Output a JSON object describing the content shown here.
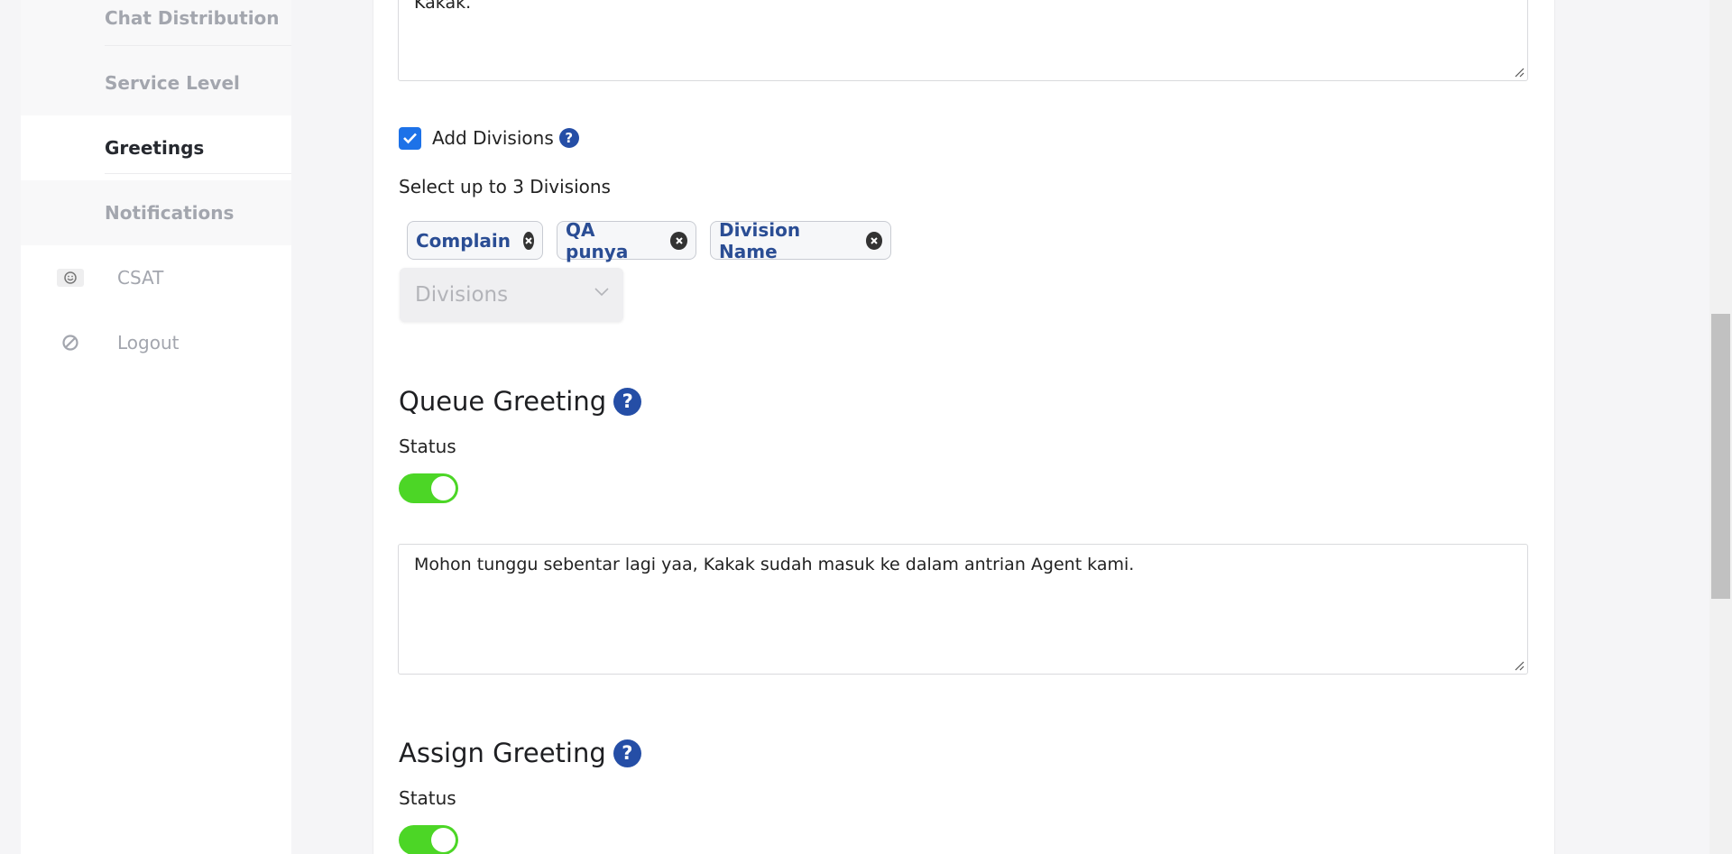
{
  "sidebar": {
    "sub_items": [
      {
        "label": "Chat Distribution"
      },
      {
        "label": "Service Level"
      },
      {
        "label": "Greetings"
      },
      {
        "label": "Notifications"
      }
    ],
    "csat_label": "CSAT",
    "logout_label": "Logout"
  },
  "greeting_top": {
    "text": "Kakak."
  },
  "divisions": {
    "checkbox_label": "Add Divisions",
    "checked": true,
    "help": "?",
    "hint": "Select up to 3 Divisions",
    "chips": [
      "Complain",
      "QA punya",
      "Division Name"
    ],
    "select_placeholder": "Divisions"
  },
  "queue_greeting": {
    "title": "Queue Greeting",
    "help": "?",
    "status_label": "Status",
    "enabled": true,
    "message": "Mohon tunggu sebentar lagi yaa, Kakak sudah masuk ke dalam antrian Agent kami."
  },
  "assign_greeting": {
    "title": "Assign Greeting",
    "help": "?",
    "status_label": "Status",
    "enabled": true
  },
  "colors": {
    "accent_blue": "#254ea6",
    "checkbox_blue": "#1d72e8",
    "toggle_green": "#4cd626"
  }
}
